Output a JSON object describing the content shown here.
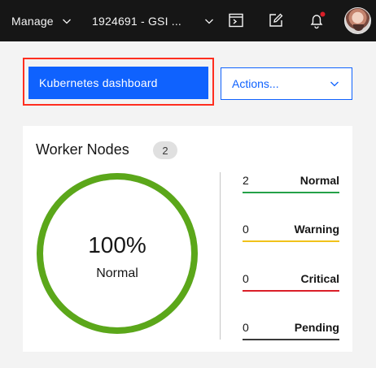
{
  "topbar": {
    "manage_label": "Manage",
    "account_label": "1924691 - GSI ...",
    "icons": [
      "terminal-icon",
      "edit-icon",
      "notification-icon",
      "user-avatar"
    ],
    "notification_dot_color": "#da1e28"
  },
  "actions": {
    "primary_label": "Kubernetes dashboard",
    "dropdown_label": "Actions...",
    "primary_color": "#0f62fe",
    "highlight_color": "#ff2e1f"
  },
  "worker_nodes": {
    "title": "Worker Nodes",
    "count": "2",
    "ring_percent": "100%",
    "ring_label": "Normal",
    "ring_color": "#5ba71a",
    "ring_fraction": 1.0,
    "statuses": [
      {
        "count": "2",
        "label": "Normal",
        "color": "#24a148"
      },
      {
        "count": "0",
        "label": "Warning",
        "color": "#f1c21b"
      },
      {
        "count": "0",
        "label": "Critical",
        "color": "#da1e28"
      },
      {
        "count": "0",
        "label": "Pending",
        "color": "#393939"
      }
    ]
  }
}
